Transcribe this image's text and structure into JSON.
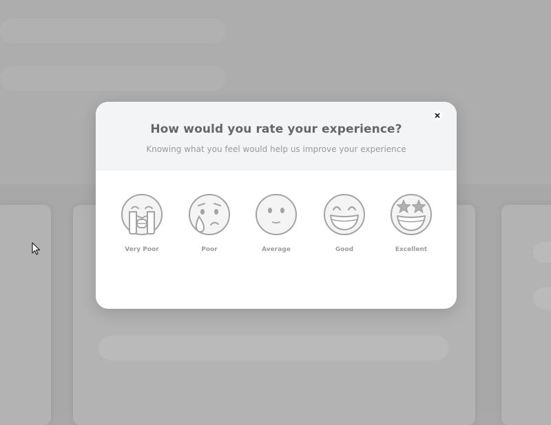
{
  "modal": {
    "title": "How would you rate your experience?",
    "subtitle": "Knowing what you feel would help us improve your experience",
    "close_icon": "close-icon"
  },
  "ratings": [
    {
      "label": "Very Poor",
      "icon": "crying-face-icon"
    },
    {
      "label": "Poor",
      "icon": "sad-tear-face-icon"
    },
    {
      "label": "Average",
      "icon": "neutral-face-icon"
    },
    {
      "label": "Good",
      "icon": "grinning-face-icon"
    },
    {
      "label": "Excellent",
      "icon": "star-struck-face-icon"
    }
  ],
  "colors": {
    "backdrop": "#a8a8a8",
    "modal_header": "#f3f4f6",
    "modal_body": "#ffffff",
    "title_text": "#666666",
    "subtitle_text": "#9a9a9a",
    "icon_stroke": "#a3a3a3"
  }
}
